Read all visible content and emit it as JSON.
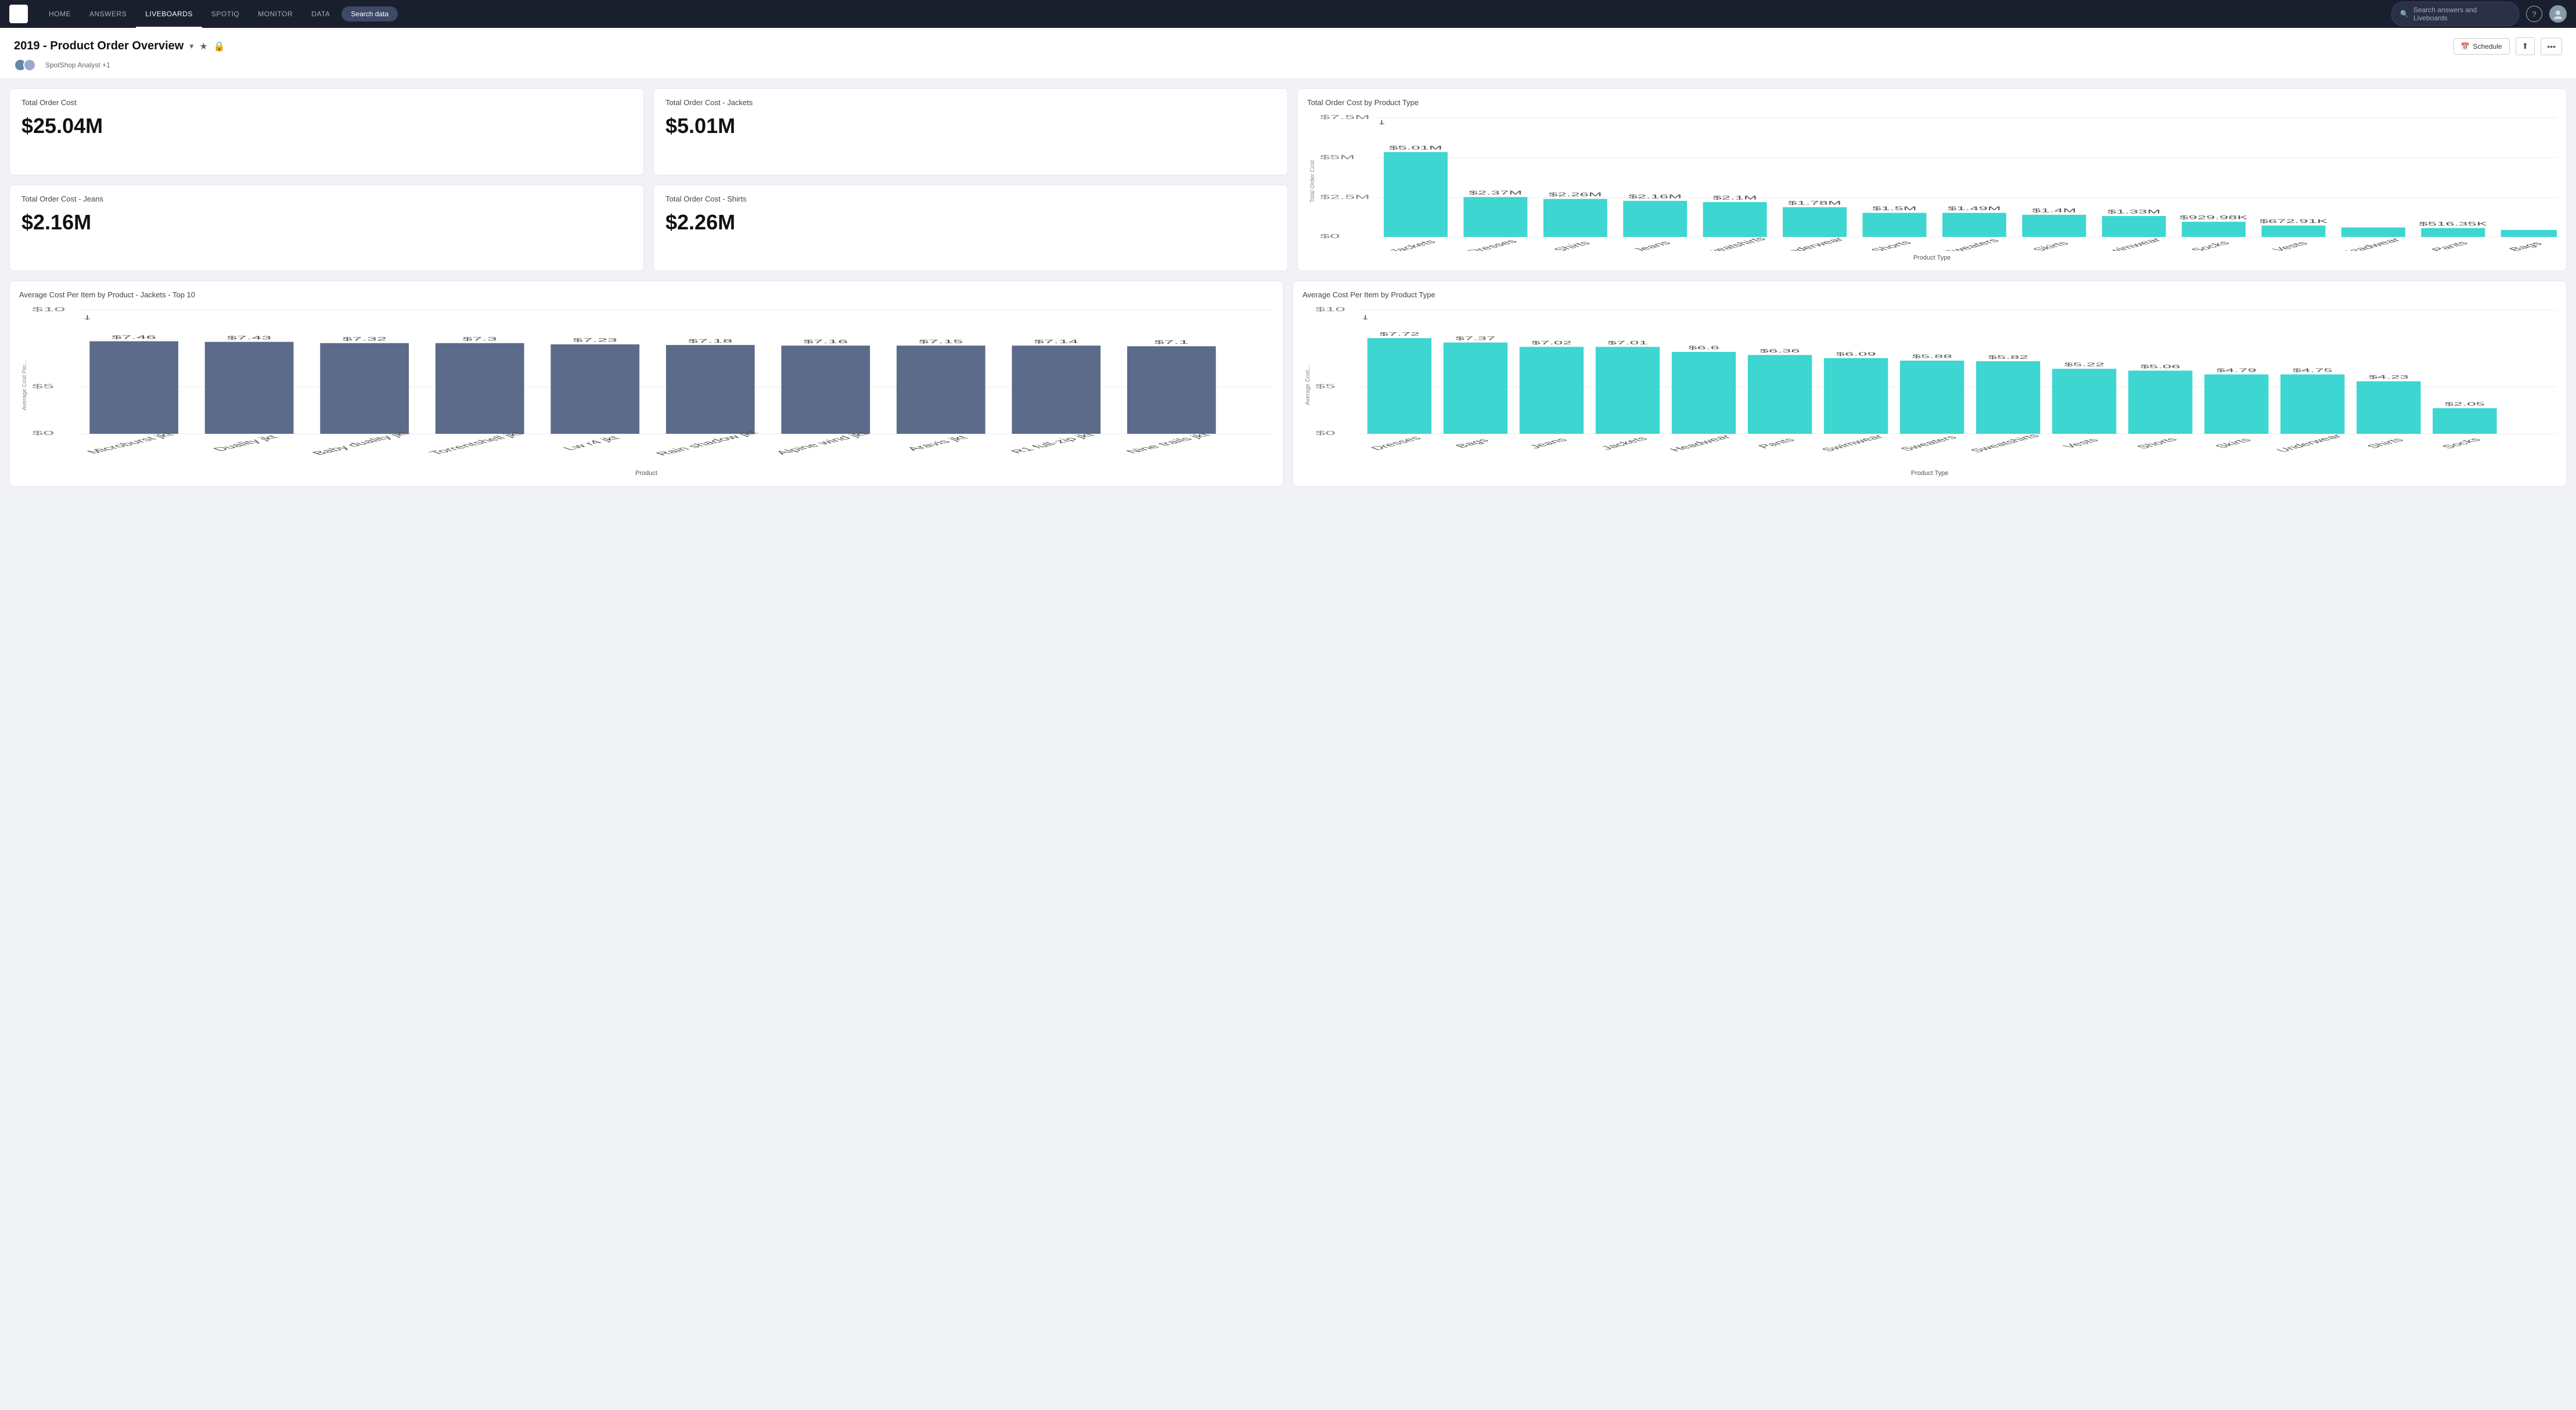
{
  "nav": {
    "logo": "T",
    "items": [
      "HOME",
      "ANSWERS",
      "LIVEBOARDS",
      "SPOTIQ",
      "MONITOR",
      "DATA"
    ],
    "active": "LIVEBOARDS",
    "search_data_label": "Search data",
    "search_placeholder": "Search answers and Liveboards"
  },
  "header": {
    "title": "2019 - Product Order Overview",
    "subtitle": "SpotShop Analyst +1",
    "schedule_label": "Schedule"
  },
  "metrics": {
    "total_order_cost": {
      "label": "Total Order Cost",
      "value": "$25.04M"
    },
    "jackets": {
      "label": "Total Order Cost - Jackets",
      "value": "$5.01M"
    },
    "jeans": {
      "label": "Total Order Cost - Jeans",
      "value": "$2.16M"
    },
    "shirts": {
      "label": "Total Order Cost - Shirts",
      "value": "$2.26M"
    }
  },
  "bar_chart_product_type": {
    "title": "Total Order Cost by Product Type",
    "x_label": "Product Type",
    "y_label": "Total Order Cost",
    "bars": [
      {
        "label": "Jackets",
        "value": 5010000,
        "display": "$5.01M"
      },
      {
        "label": "Dresses",
        "value": 2370000,
        "display": "$2.37M"
      },
      {
        "label": "Shirts",
        "value": 2260000,
        "display": "$2.26M"
      },
      {
        "label": "Jeans",
        "value": 2160000,
        "display": "$2.16M"
      },
      {
        "label": "Sweatshirts",
        "value": 2100000,
        "display": "$2.1M"
      },
      {
        "label": "Underwear",
        "value": 1780000,
        "display": "$1.78M"
      },
      {
        "label": "Shorts",
        "value": 1500000,
        "display": "$1.5M"
      },
      {
        "label": "Sweaters",
        "value": 1490000,
        "display": "$1.49M"
      },
      {
        "label": "Skirts",
        "value": 1400000,
        "display": "$1.4M"
      },
      {
        "label": "Swimwear",
        "value": 1330000,
        "display": "$1.33M"
      },
      {
        "label": "Socks",
        "value": 929980,
        "display": "$929.98K"
      },
      {
        "label": "Vests",
        "value": 672910,
        "display": "$672.91K"
      },
      {
        "label": "Headwear",
        "value": 600000,
        "display": ""
      },
      {
        "label": "Pants",
        "value": 516350,
        "display": "$516.35K"
      },
      {
        "label": "Bags",
        "value": 400000,
        "display": ""
      }
    ],
    "max_value": 7500000,
    "color": "#3dd6d0"
  },
  "bar_chart_jackets_top10": {
    "title": "Average Cost Per Item by Product - Jackets - Top 10",
    "x_label": "Product",
    "y_label": "Average Cost Per...",
    "bars": [
      {
        "label": "Microburst jkt",
        "value": 7.46,
        "display": "$7.46"
      },
      {
        "label": "Duality jkt",
        "value": 7.43,
        "display": "$7.43"
      },
      {
        "label": "Baby duality jkt",
        "value": 7.32,
        "display": "$7.32"
      },
      {
        "label": "Torrentshell jkt",
        "value": 7.3,
        "display": "$7.3"
      },
      {
        "label": "Lw r4 jkt",
        "value": 7.23,
        "display": "$7.23"
      },
      {
        "label": "Rain shadow jkt",
        "value": 7.18,
        "display": "$7.18"
      },
      {
        "label": "Alpine wind jkt",
        "value": 7.16,
        "display": "$7.16"
      },
      {
        "label": "Aravis jkt",
        "value": 7.15,
        "display": "$7.15"
      },
      {
        "label": "R1 full-zip jkt",
        "value": 7.14,
        "display": "$7.14"
      },
      {
        "label": "Nine trails jkt",
        "value": 7.1,
        "display": "$7.1"
      }
    ],
    "max_value": 10,
    "color": "#5c6b8a"
  },
  "bar_chart_product_type_avg": {
    "title": "Average Cost Per Item by Product Type",
    "x_label": "Product Type",
    "y_label": "Average Cost...",
    "bars": [
      {
        "label": "Dresses",
        "value": 7.72,
        "display": "$7.72"
      },
      {
        "label": "Bags",
        "value": 7.37,
        "display": "$7.37"
      },
      {
        "label": "Jeans",
        "value": 7.02,
        "display": "$7.02"
      },
      {
        "label": "Jackets",
        "value": 7.01,
        "display": "$7.01"
      },
      {
        "label": "Headwear",
        "value": 6.6,
        "display": "$6.6"
      },
      {
        "label": "Pants",
        "value": 6.36,
        "display": "$6.36"
      },
      {
        "label": "Swimwear",
        "value": 6.09,
        "display": "$6.09"
      },
      {
        "label": "Sweaters",
        "value": 5.88,
        "display": "$5.88"
      },
      {
        "label": "Sweatshirts",
        "value": 5.82,
        "display": "$5.82"
      },
      {
        "label": "Vests",
        "value": 5.22,
        "display": "$5.22"
      },
      {
        "label": "Shorts",
        "value": 5.06,
        "display": "$5.06"
      },
      {
        "label": "Skirts",
        "value": 4.79,
        "display": "$4.79"
      },
      {
        "label": "Underwear",
        "value": 4.75,
        "display": "$4.75"
      },
      {
        "label": "Shirts",
        "value": 4.23,
        "display": "$4.23"
      },
      {
        "label": "Socks",
        "value": 2.05,
        "display": "$2.05"
      }
    ],
    "max_value": 10,
    "color": "#3dd6d0"
  }
}
